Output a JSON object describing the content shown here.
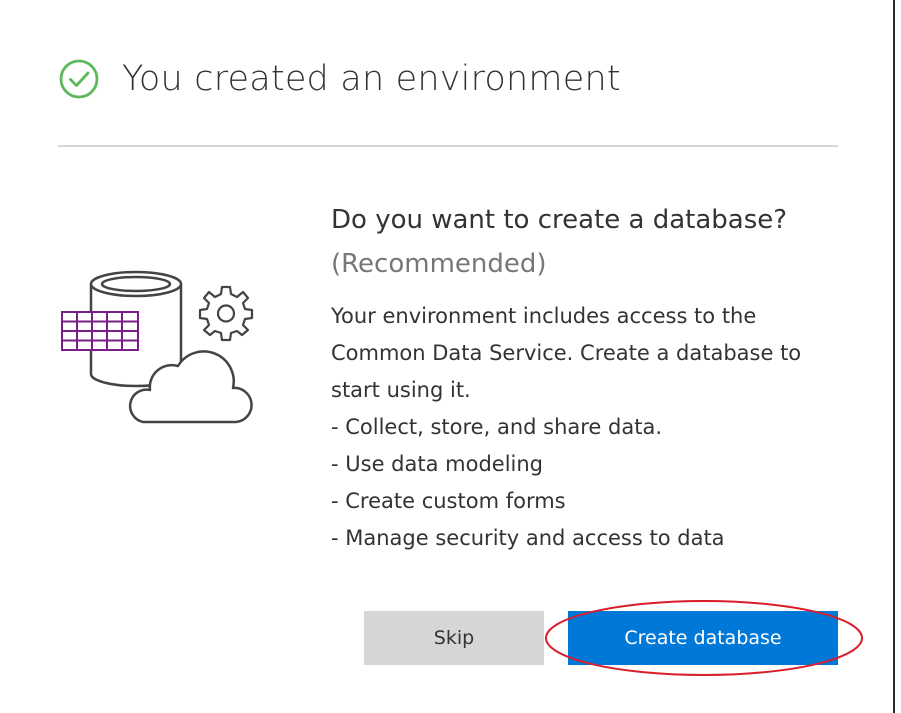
{
  "dialog": {
    "title": "You created an environment",
    "question": "Do you want to create a database?",
    "recommended": "(Recommended)",
    "description_lines": [
      "Your environment includes access to the",
      "Common Data Service. Create a database to",
      "start using it.",
      "- Collect, store, and share data.",
      "- Use data modeling",
      "- Create custom forms",
      "- Manage security and access to data"
    ]
  },
  "buttons": {
    "skip": "Skip",
    "create": "Create database"
  },
  "icons": {
    "status": "check-circle-icon",
    "illustration": "database-cloud-illustration"
  },
  "colors": {
    "success": "#5cb85c",
    "primary": "#0078d7",
    "secondary_button": "#d6d6d6",
    "annotation": "#d81e2a",
    "grid_purple": "#7a1f8a"
  }
}
